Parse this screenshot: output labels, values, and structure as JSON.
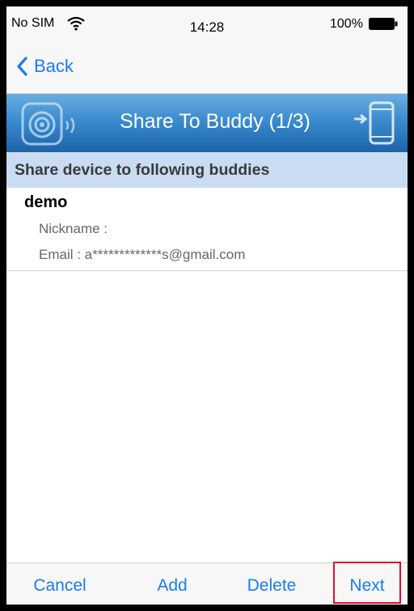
{
  "status_bar": {
    "carrier": "No SIM",
    "time": "14:28",
    "battery": "100%"
  },
  "nav": {
    "back_label": "Back"
  },
  "banner": {
    "title": "Share To Buddy (1/3)"
  },
  "section": {
    "header": "Share device to following buddies"
  },
  "buddies": [
    {
      "name": "demo",
      "nickname": "Nickname :",
      "email": "Email : a*************s@gmail.com"
    }
  ],
  "toolbar": {
    "cancel_label": "Cancel",
    "add_label": "Add",
    "delete_label": "Delete",
    "next_label": "Next"
  },
  "colors": {
    "accent": "#1a7cf5",
    "banner": "#3b8bcf",
    "section_header": "#c9dcf1",
    "highlight": "#e0102a"
  },
  "icons": [
    "wifi-icon",
    "battery-icon",
    "back-chevron-icon",
    "camera-icon",
    "phone-share-icon"
  ]
}
